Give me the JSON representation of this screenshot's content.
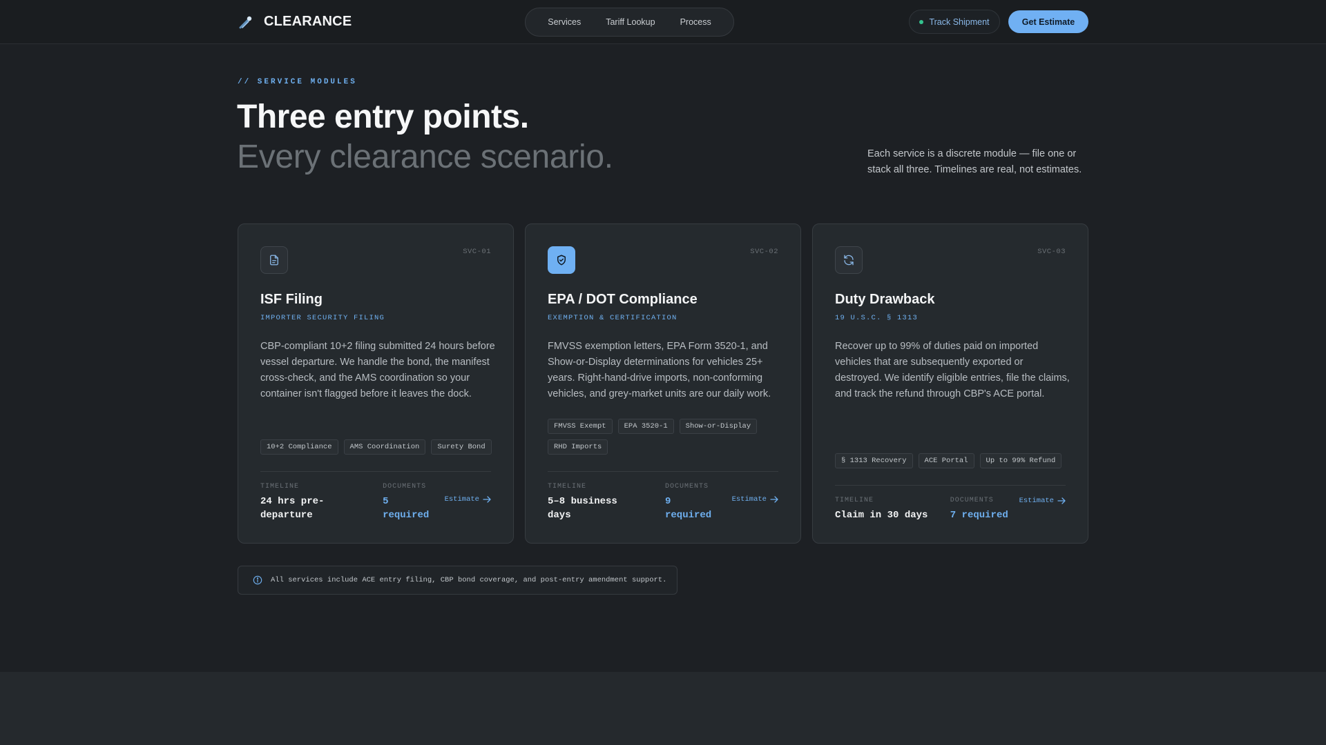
{
  "header": {
    "brand": "CLEARANCE",
    "nav": [
      "Services",
      "Tariff Lookup",
      "Process"
    ],
    "track_label": "Track Shipment",
    "cta_label": "Get Estimate"
  },
  "hero": {
    "eyebrow": "// SERVICE MODULES",
    "title": "Three entry points.",
    "subtitle": "Every clearance scenario.",
    "lead": "Each service is a discrete module — file one or stack all three. Timelines are real, not estimates."
  },
  "cards": [
    {
      "code": "SVC-01",
      "icon": "document-icon",
      "title": "ISF Filing",
      "subtitle": "IMPORTER SECURITY FILING",
      "description": "CBP-compliant 10+2 filing submitted 24 hours before vessel departure. We handle the bond, the manifest cross-check, and the AMS coordination so your container isn't flagged before it leaves the dock.",
      "tags": [
        "10+2 Compliance",
        "AMS Coordination",
        "Surety Bond"
      ],
      "timeline_label": "TIMELINE",
      "timeline": "24 hrs pre-departure",
      "documents_label": "DOCUMENTS",
      "documents": "5 required",
      "link": "Estimate"
    },
    {
      "code": "SVC-02",
      "icon": "shield-check-icon",
      "title": "EPA / DOT Compliance",
      "subtitle": "EXEMPTION & CERTIFICATION",
      "description": "FMVSS exemption letters, EPA Form 3520-1, and Show-or-Display determinations for vehicles 25+ years. Right-hand-drive imports, non-conforming vehicles, and grey-market units are our daily work.",
      "tags": [
        "FMVSS Exempt",
        "EPA 3520-1",
        "Show-or-Display",
        "RHD Imports"
      ],
      "timeline_label": "TIMELINE",
      "timeline": "5–8 business days",
      "documents_label": "DOCUMENTS",
      "documents": "9 required",
      "link": "Estimate"
    },
    {
      "code": "SVC-03",
      "icon": "refresh-icon",
      "title": "Duty Drawback",
      "subtitle": "19 U.S.C. § 1313",
      "description": "Recover up to 99% of duties paid on imported vehicles that are subsequently exported or destroyed. We identify eligible entries, file the claims, and track the refund through CBP's ACE portal.",
      "tags": [
        "§ 1313 Recovery",
        "ACE Portal",
        "Up to 99% Refund"
      ],
      "timeline_label": "TIMELINE",
      "timeline": "Claim in 30 days",
      "documents_label": "DOCUMENTS",
      "documents": "7 required",
      "link": "Estimate"
    }
  ],
  "note": "All services include ACE entry filing, CBP bond coverage, and post-entry amendment support.",
  "colors": {
    "accent": "#6fb0f0",
    "background": "#1d2024",
    "card": "#252a2e",
    "status_dot": "#34c38f"
  }
}
